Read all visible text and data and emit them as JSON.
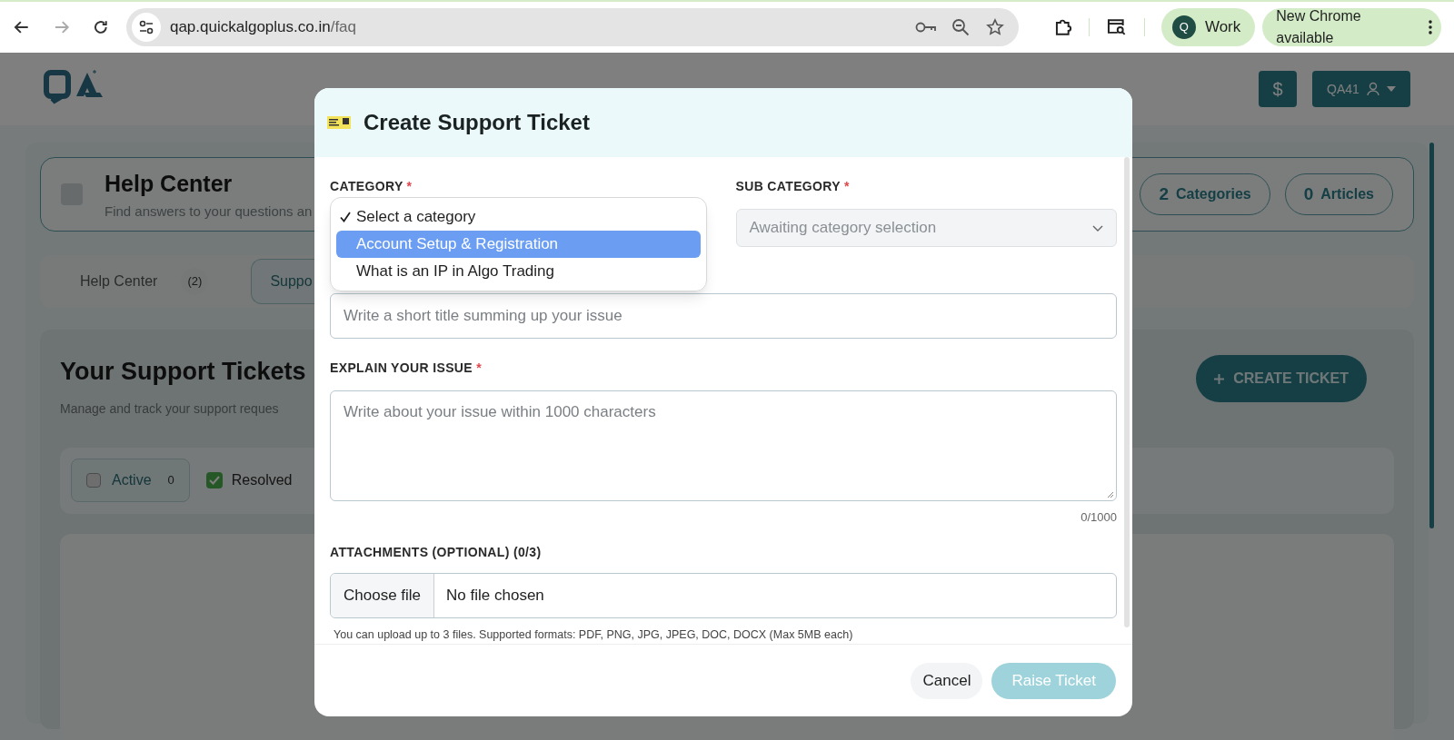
{
  "browser": {
    "url_host": "qap.quickalgoplus.co.in",
    "url_path": "/faq",
    "profile_initial": "Q",
    "profile_label": "Work",
    "update_label": "New Chrome available"
  },
  "app": {
    "currency": "$",
    "account": "QA41"
  },
  "help_center": {
    "title": "Help Center",
    "subtitle": "Find answers to your questions an",
    "stats": [
      {
        "count": "2",
        "label": "Categories"
      },
      {
        "count": "0",
        "label": "Articles"
      }
    ]
  },
  "tabs": [
    {
      "label": "Help Center",
      "count": "(2)",
      "selected": false
    },
    {
      "label": "Suppo",
      "selected": true
    }
  ],
  "tickets": {
    "title": "Your Support Tickets",
    "subtitle": "Manage and track your support reques",
    "create_button": "CREATE TICKET",
    "filters": [
      {
        "label": "Active",
        "count": "0",
        "selected": true,
        "checked": false
      },
      {
        "label": "Resolved",
        "selected": false,
        "checked": true
      }
    ]
  },
  "modal": {
    "title": "Create Support Ticket",
    "category": {
      "label": "CATEGORY",
      "required_mark": "*",
      "options": [
        {
          "label": "Select a category",
          "checked": true,
          "selected": false
        },
        {
          "label": "Account Setup & Registration",
          "checked": false,
          "selected": true
        },
        {
          "label": "What is an IP in Algo Trading",
          "checked": false,
          "selected": false
        }
      ]
    },
    "sub_category": {
      "label": "SUB CATEGORY",
      "required_mark": "*",
      "placeholder": "Awaiting category selection",
      "disabled": true
    },
    "title_field": {
      "placeholder": "Write a short title summing up your issue"
    },
    "explain": {
      "label": "EXPLAIN YOUR ISSUE",
      "required_mark": "*",
      "placeholder": "Write about your issue within 1000 characters",
      "counter": "0/1000"
    },
    "attachments": {
      "label": "ATTACHMENTS (OPTIONAL) (0/3)",
      "button": "Choose file",
      "status": "No file chosen",
      "hint": "You can upload up to 3 files. Supported formats: PDF, PNG, JPG, JPEG, DOC, DOCX (Max 5MB each)"
    },
    "cancel": "Cancel",
    "submit": {
      "label": "Raise Ticket",
      "disabled": true
    }
  }
}
